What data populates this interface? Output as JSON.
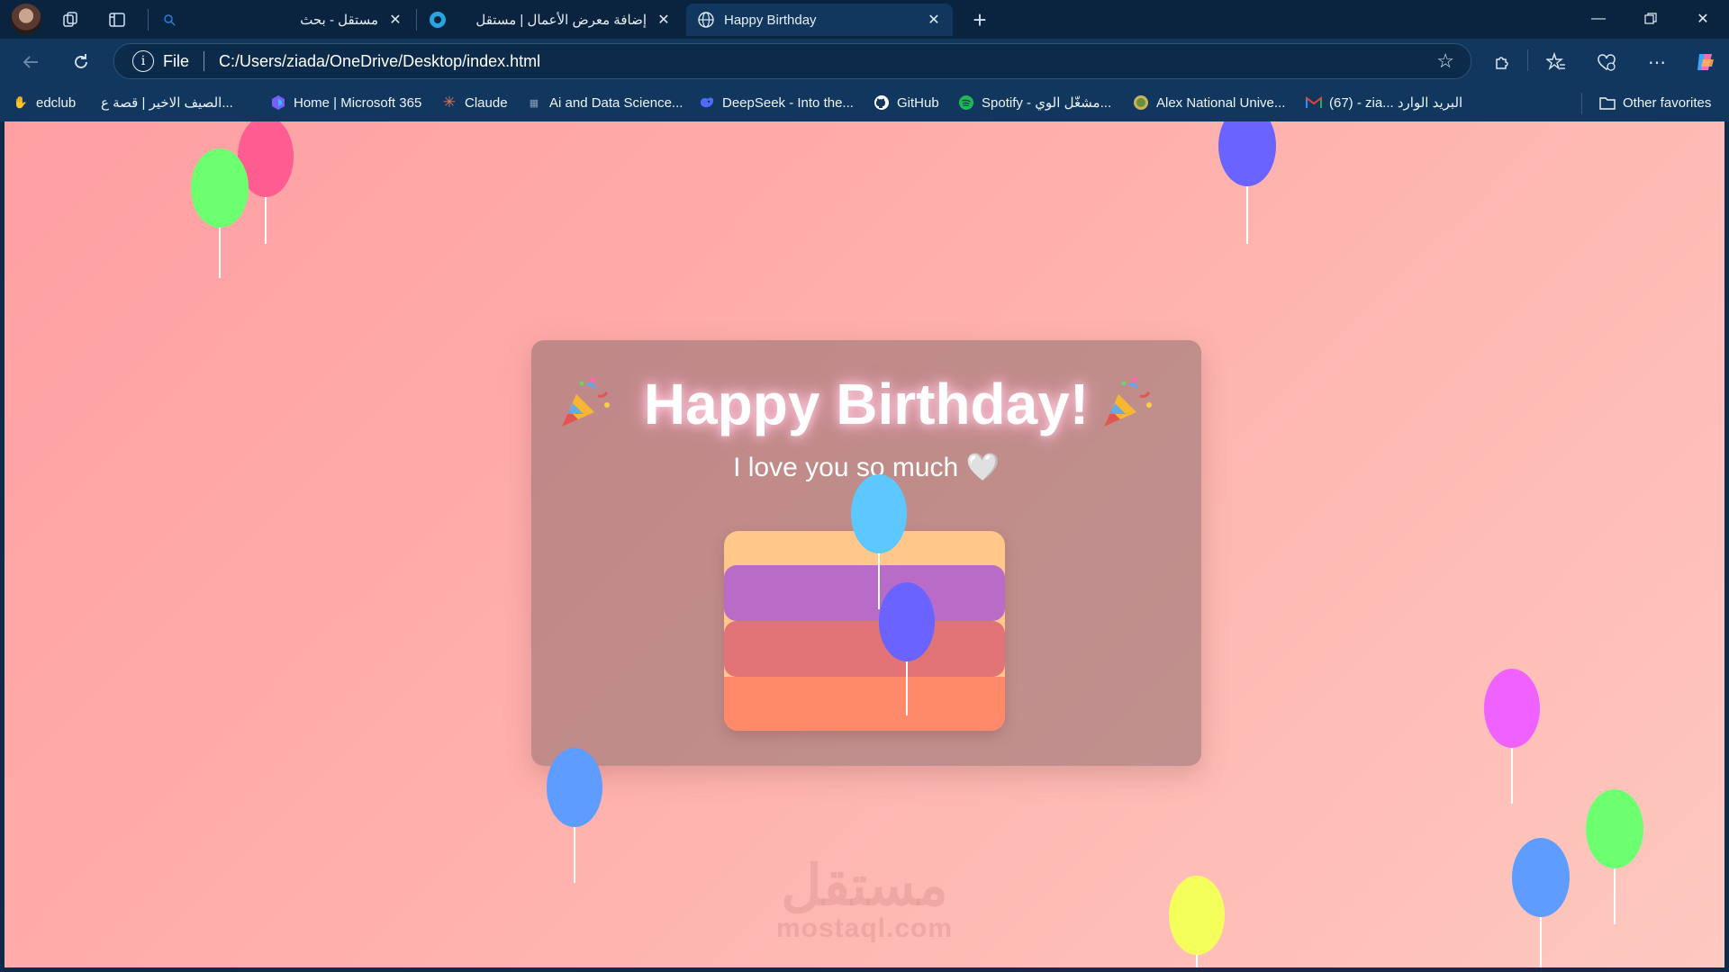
{
  "browser": {
    "tabs": [
      {
        "title": "مستقل - بحث",
        "active": false
      },
      {
        "title": "إضافة معرض الأعمال | مستقل",
        "active": false
      },
      {
        "title": "Happy Birthday",
        "active": true
      }
    ],
    "address": {
      "scheme": "File",
      "url": "C:/Users/ziada/OneDrive/Desktop/index.html"
    },
    "favorites": [
      {
        "label": "edclub",
        "icon": "hand-icon",
        "color": "#f6a623"
      },
      {
        "label": "الصيف الاخير | قصة ع...",
        "icon": "page-icon",
        "color": "#8aa0b8"
      },
      {
        "label": "Home | Microsoft 365",
        "icon": "m365-icon",
        "color": "#7b5cff"
      },
      {
        "label": "Claude",
        "icon": "claude-icon",
        "color": "#d97757"
      },
      {
        "label": "Ai and Data Science...",
        "icon": "course-icon",
        "color": "#5a6f8a"
      },
      {
        "label": "DeepSeek - Into the...",
        "icon": "deepseek-icon",
        "color": "#4d6bfe"
      },
      {
        "label": "GitHub",
        "icon": "github-icon",
        "color": "#ffffff"
      },
      {
        "label": "Spotify - مشغّل الوي...",
        "icon": "spotify-icon",
        "color": "#1db954"
      },
      {
        "label": "Alex National Unive...",
        "icon": "university-icon",
        "color": "#6b8e3a"
      },
      {
        "label": "(67) - zia... البريد الوارد",
        "icon": "gmail-icon",
        "color": "#ea4335"
      }
    ],
    "other_favorites": "Other favorites"
  },
  "page": {
    "headline": "Happy Birthday!",
    "subline": "I love you so much 🤍",
    "popper_emoji": "party-popper-icon",
    "cake_colors": [
      "#ffc78a",
      "#b86cc8",
      "#e27376",
      "#ff8a6a"
    ],
    "balloons": [
      {
        "name": "balloon-pink",
        "color": "#ff5c92"
      },
      {
        "name": "balloon-green",
        "color": "#6cff70"
      },
      {
        "name": "balloon-indigo",
        "color": "#6a63ff"
      },
      {
        "name": "balloon-sky",
        "color": "#5cc8ff"
      },
      {
        "name": "balloon-violet",
        "color": "#6a63ff"
      },
      {
        "name": "balloon-blue",
        "color": "#5e9cff"
      },
      {
        "name": "balloon-magenta",
        "color": "#f062ff"
      },
      {
        "name": "balloon-green-2",
        "color": "#6cff70"
      },
      {
        "name": "balloon-blue-2",
        "color": "#5e9cff"
      },
      {
        "name": "balloon-yellow",
        "color": "#f5ff5c"
      }
    ],
    "watermark_ar": "مستقل",
    "watermark_en": "mostaql.com"
  }
}
